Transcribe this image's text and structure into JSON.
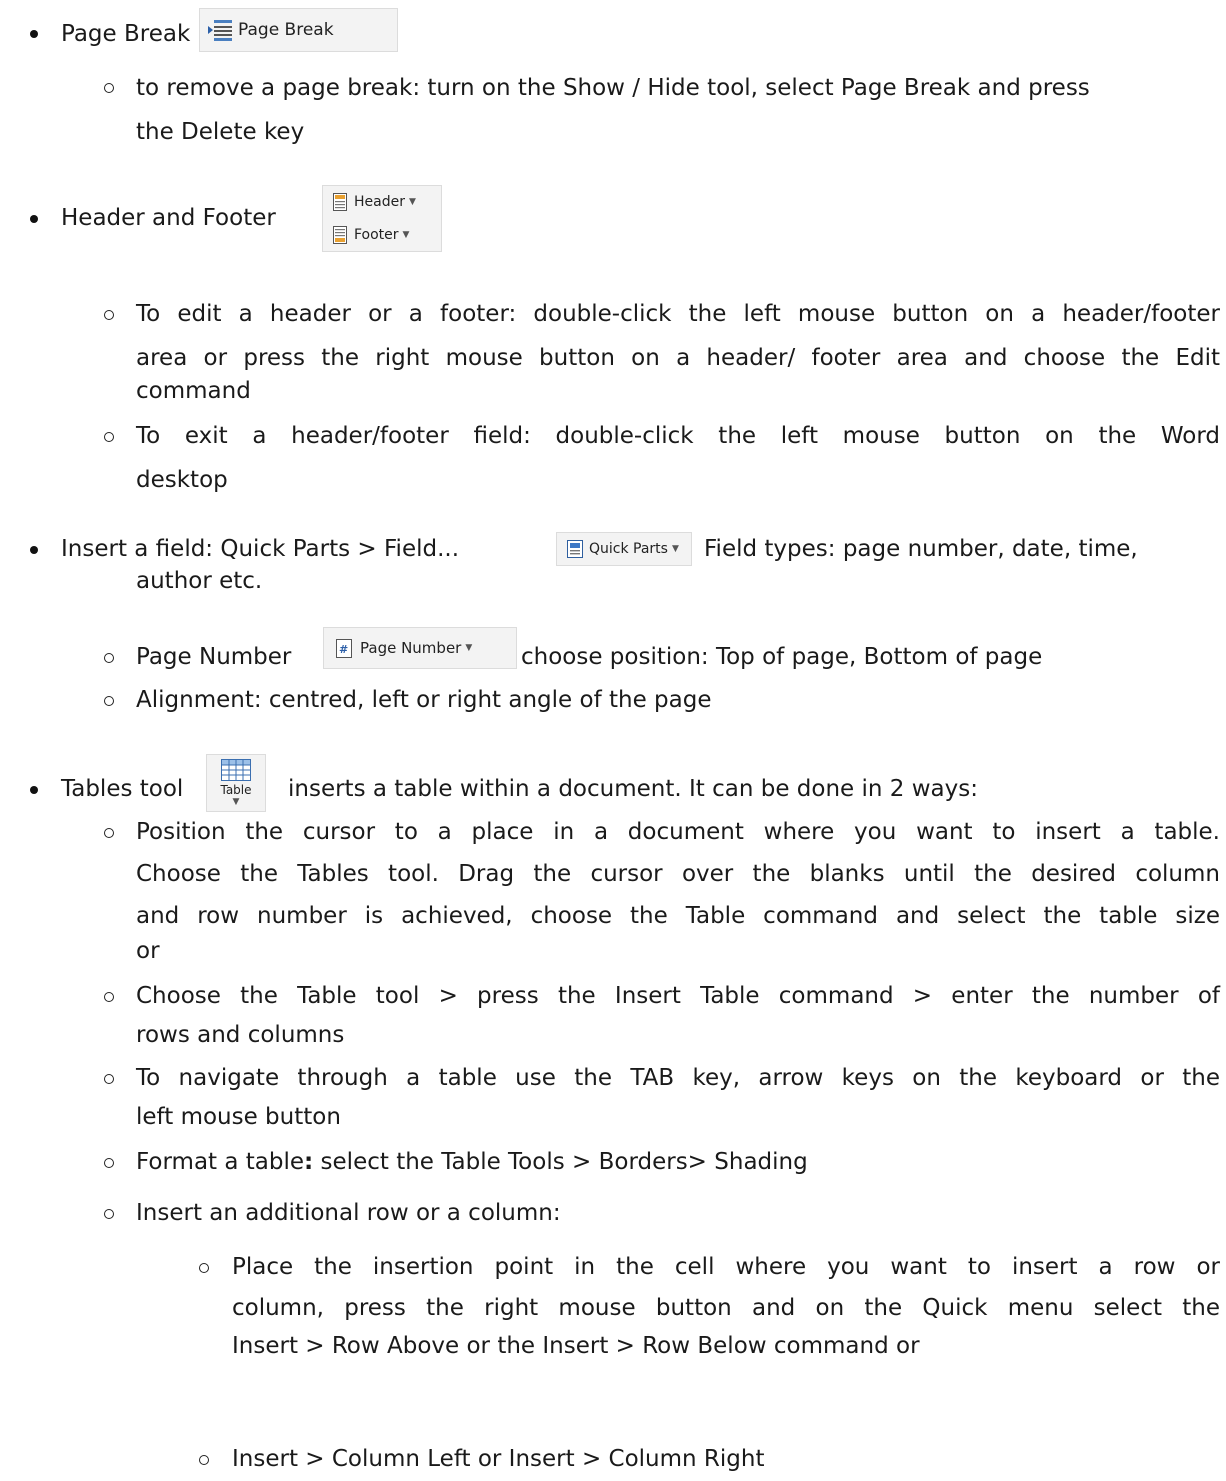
{
  "items": {
    "page_break": "Page Break",
    "page_break_remove_1": "to remove a page break: turn on the Show / Hide tool, select Page Break and press",
    "page_break_remove_2": "the Delete key",
    "header_footer": "Header and Footer",
    "hf_edit_1": "To edit a header or a footer: double-click the left mouse button on a header/footer",
    "hf_edit_2": "area or press the right mouse button on a header/ footer area and choose the Edit",
    "hf_edit_3": "command",
    "hf_exit_1": "To exit a header/footer field: double-click the left mouse button on the Word",
    "hf_exit_2": "desktop",
    "field_a": "Insert a field: Quick Parts > Field...",
    "field_b": "Field types: page number, date, time,",
    "field_c": "author etc.",
    "page_number": "Page Number",
    "page_number_rest": "choose position: Top of page, Bottom of page",
    "alignment": "Alignment: centred, left or right angle of the page",
    "tables_tool": "Tables tool",
    "tables_rest": "inserts a table within a document. It can be done in 2 ways:",
    "pos_1": "Position the cursor to a place in a document where you want to insert a table.",
    "pos_2": "Choose the Tables tool. Drag the cursor over the blanks until the desired column",
    "pos_3": "and row number is achieved, choose the Table command and select the table size",
    "pos_4": "or",
    "choose_1": "Choose the Table tool > press the Insert Table command > enter the number of",
    "choose_2": "rows and columns",
    "nav_1": "To navigate through a table use the TAB key, arrow keys on the keyboard or the",
    "nav_2": "left mouse button",
    "format_a": "Format a table",
    "format_b": "select the Table Tools > Borders> Shading",
    "insert_row": "Insert an additional row or a column:",
    "place_1": "Place the insertion point in the cell where you want to insert a row or",
    "place_2": "column, press the right mouse button and on the Quick menu select the",
    "place_3": "Insert > Row Above or the Insert > Row Below command or",
    "col_lr": "Insert > Column Left or Insert > Column Right"
  },
  "buttons": {
    "page_break": "Page Break",
    "header": "Header",
    "footer": "Footer",
    "quick_parts": "Quick Parts",
    "page_number": "Page Number",
    "table": "Table"
  },
  "icons": {
    "page_break": "page-break-icon",
    "header": "header-icon",
    "footer": "footer-icon",
    "quick_parts": "quick-parts-icon",
    "page_number": "page-number-icon",
    "table": "table-grid-icon",
    "dropdown": "dropdown-arrow-icon"
  }
}
